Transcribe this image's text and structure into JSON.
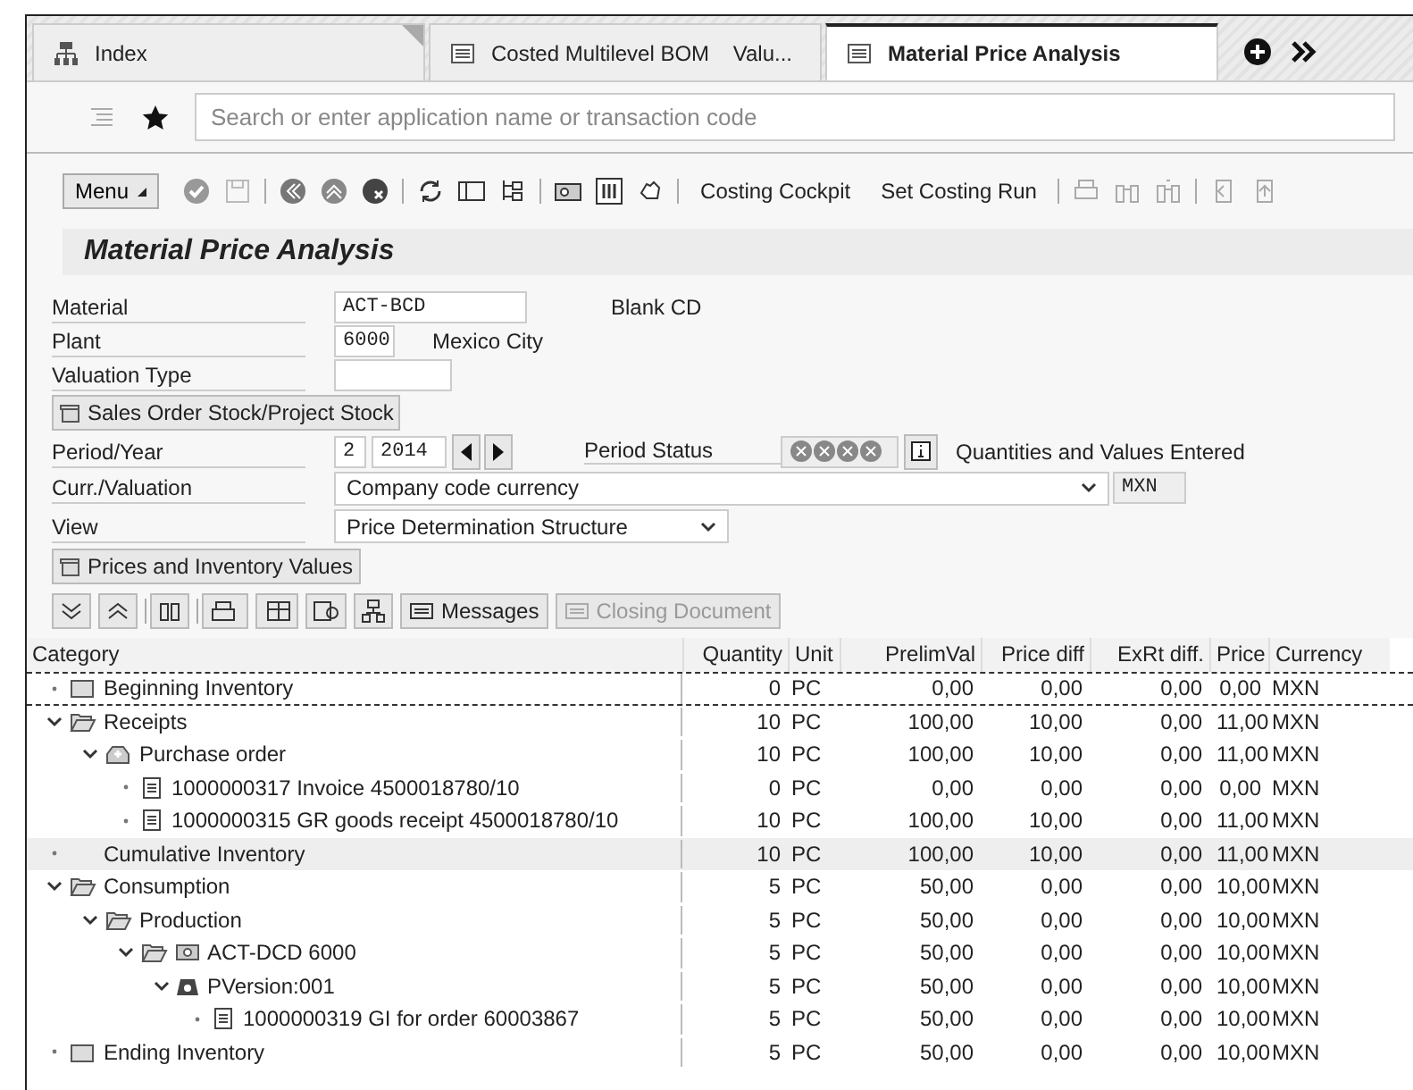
{
  "tabs": [
    {
      "label": "Index",
      "kind": "index",
      "selected": false
    },
    {
      "label": "Costed Multilevel BOM    Valu...",
      "kind": "list",
      "selected": false
    },
    {
      "label": "Material Price Analysis",
      "kind": "list",
      "selected": true
    }
  ],
  "search": {
    "placeholder": "Search or enter application name or transaction code"
  },
  "toolbar": {
    "menu": "Menu",
    "links": [
      "Costing Cockpit",
      "Set Costing Run"
    ]
  },
  "title": "Material Price Analysis",
  "material": {
    "label": "Material",
    "value": "ACT-BCD",
    "description": "Blank CD"
  },
  "plant": {
    "label": "Plant",
    "value": "6000",
    "description": "Mexico City"
  },
  "valuation_type": {
    "label": "Valuation Type"
  },
  "sales_order_button": "Sales Order Stock/Project Stock",
  "period": {
    "label": "Period/Year",
    "period": "2",
    "year": "2014",
    "status_label": "Period Status",
    "status_text": "Quantities and Values Entered"
  },
  "currency": {
    "label": "Curr./Valuation",
    "value": "Company code currency",
    "unit": "MXN"
  },
  "view": {
    "label": "View",
    "value": "Price Determination Structure"
  },
  "prices_button": "Prices and Inventory Values",
  "grid_buttons": [
    {
      "label": "Messages",
      "disabled": false
    },
    {
      "label": "Closing Document",
      "disabled": true
    }
  ],
  "table": {
    "columns": [
      "Category",
      "Quantity",
      "Unit",
      "PrelimVal",
      "Price diff",
      "ExRt diff.",
      "Price",
      "Currency"
    ],
    "rows": [
      {
        "category": "Beginning Inventory",
        "kind": "folder",
        "selected": false,
        "focused": true,
        "quantity": "0",
        "unit": "PC",
        "prelim_val": "0,00",
        "price_diff": "0,00",
        "exrt_diff": "0,00",
        "price": "0,00",
        "currency": "MXN"
      },
      {
        "category": "Receipts",
        "kind": "folder-open",
        "expanded": true,
        "selected": false,
        "focused": false,
        "quantity": "10",
        "unit": "PC",
        "prelim_val": "100,00",
        "price_diff": "10,00",
        "exrt_diff": "0,00",
        "price": "11,00",
        "currency": "MXN",
        "children": [
          {
            "category": "Purchase order",
            "kind": "order",
            "expanded": true,
            "selected": false,
            "focused": false,
            "quantity": "10",
            "unit": "PC",
            "prelim_val": "100,00",
            "price_diff": "10,00",
            "exrt_diff": "0,00",
            "price": "11,00",
            "currency": "MXN",
            "children": [
              {
                "category": "1000000317 Invoice 4500018780/10",
                "kind": "document",
                "selected": false,
                "focused": false,
                "quantity": "0",
                "unit": "PC",
                "prelim_val": "0,00",
                "price_diff": "0,00",
                "exrt_diff": "0,00",
                "price": "0,00",
                "currency": "MXN"
              },
              {
                "category": "1000000315 GR goods receipt 4500018780/10",
                "kind": "document",
                "selected": false,
                "focused": false,
                "quantity": "10",
                "unit": "PC",
                "prelim_val": "100,00",
                "price_diff": "10,00",
                "exrt_diff": "0,00",
                "price": "11,00",
                "currency": "MXN"
              }
            ]
          }
        ]
      },
      {
        "category": "Cumulative Inventory",
        "kind": "plain",
        "selected": true,
        "focused": false,
        "quantity": "10",
        "unit": "PC",
        "prelim_val": "100,00",
        "price_diff": "10,00",
        "exrt_diff": "0,00",
        "price": "11,00",
        "currency": "MXN"
      },
      {
        "category": "Consumption",
        "kind": "folder-open",
        "expanded": true,
        "selected": false,
        "focused": false,
        "quantity": "5",
        "unit": "PC",
        "prelim_val": "50,00",
        "price_diff": "0,00",
        "exrt_diff": "0,00",
        "price": "10,00",
        "currency": "MXN",
        "children": [
          {
            "category": "Production",
            "kind": "folder-open",
            "expanded": true,
            "selected": false,
            "focused": false,
            "quantity": "5",
            "unit": "PC",
            "prelim_val": "50,00",
            "price_diff": "0,00",
            "exrt_diff": "0,00",
            "price": "10,00",
            "currency": "MXN",
            "children": [
              {
                "category": "ACT-DCD 6000",
                "kind": "folder-material",
                "expanded": true,
                "selected": false,
                "focused": false,
                "quantity": "5",
                "unit": "PC",
                "prelim_val": "50,00",
                "price_diff": "0,00",
                "exrt_diff": "0,00",
                "price": "10,00",
                "currency": "MXN",
                "children": [
                  {
                    "category": "PVersion:001",
                    "kind": "version",
                    "expanded": true,
                    "selected": false,
                    "focused": false,
                    "quantity": "5",
                    "unit": "PC",
                    "prelim_val": "50,00",
                    "price_diff": "0,00",
                    "exrt_diff": "0,00",
                    "price": "10,00",
                    "currency": "MXN",
                    "children": [
                      {
                        "category": "1000000319 GI for order 60003867",
                        "kind": "document",
                        "selected": false,
                        "focused": false,
                        "quantity": "5",
                        "unit": "PC",
                        "prelim_val": "50,00",
                        "price_diff": "0,00",
                        "exrt_diff": "0,00",
                        "price": "10,00",
                        "currency": "MXN"
                      }
                    ]
                  }
                ]
              }
            ]
          }
        ]
      },
      {
        "category": "Ending Inventory",
        "kind": "folder",
        "selected": false,
        "focused": false,
        "quantity": "5",
        "unit": "PC",
        "prelim_val": "50,00",
        "price_diff": "0,00",
        "exrt_diff": "0,00",
        "price": "10,00",
        "currency": "MXN"
      }
    ]
  }
}
